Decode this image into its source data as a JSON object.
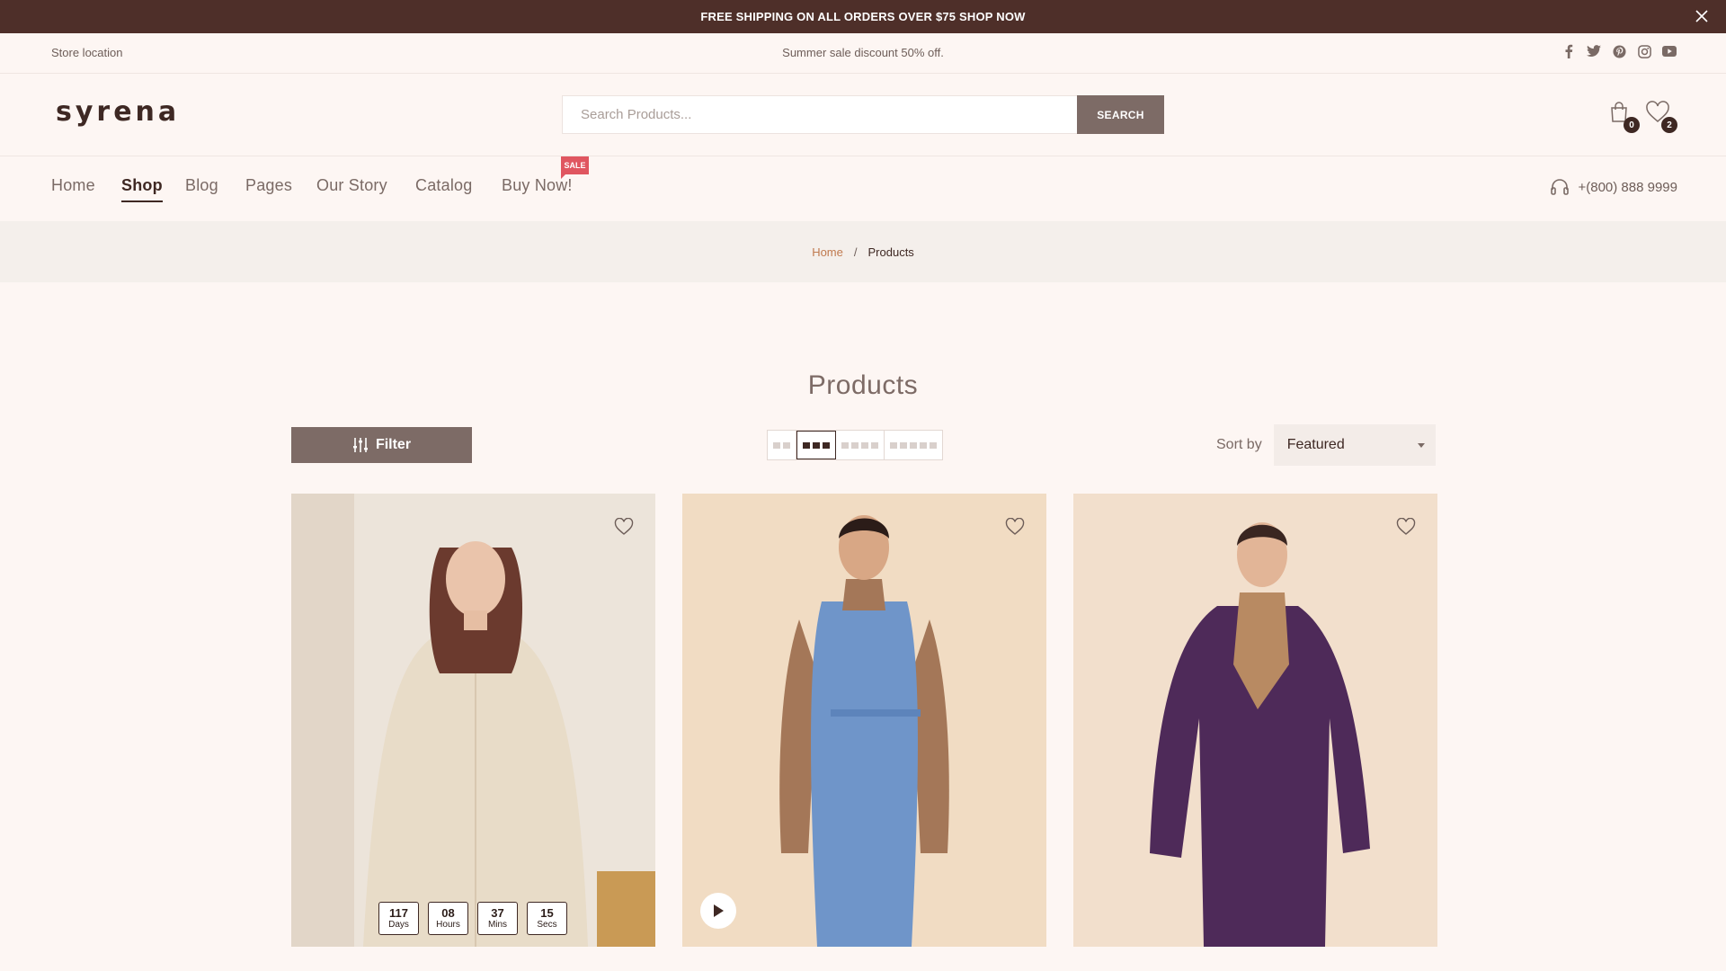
{
  "announcement": {
    "text": "FREE SHIPPING ON ALL ORDERS OVER $75 SHOP NOW"
  },
  "topbar": {
    "store_location": "Store location",
    "promo": "Summer sale discount 50% off.",
    "socials": [
      "facebook-icon",
      "twitter-icon",
      "pinterest-icon",
      "instagram-icon",
      "youtube-icon"
    ]
  },
  "header": {
    "logo": "syrena",
    "search_placeholder": "Search Products...",
    "search_button": "SEARCH",
    "cart_count": "0",
    "wishlist_count": "2"
  },
  "nav": {
    "items": [
      "Home",
      "Shop",
      "Blog",
      "Pages",
      "Our Story",
      "Catalog",
      "Buy Now!"
    ],
    "active": "Shop",
    "sale_badge": "SALE",
    "phone": "+(800) 888 9999"
  },
  "breadcrumb": {
    "home": "Home",
    "separator": "/",
    "current": "Products"
  },
  "page_title": "Products",
  "toolbar": {
    "filter_label": "Filter",
    "grid_options": [
      2,
      3,
      4,
      5
    ],
    "grid_selected": 3,
    "sort_label": "Sort by",
    "sort_value": "Featured"
  },
  "products": [
    {
      "countdown": [
        {
          "num": "117",
          "unit": "Days"
        },
        {
          "num": "08",
          "unit": "Hours"
        },
        {
          "num": "37",
          "unit": "Mins"
        },
        {
          "num": "15",
          "unit": "Secs"
        }
      ],
      "bg": "#ece4da",
      "garment": "#e8dcc8"
    },
    {
      "has_video": true,
      "bg": "#f1dcc3",
      "garment": "#6f95c9"
    },
    {
      "bg": "#f2dfcc",
      "garment": "#4e2a59"
    }
  ],
  "colors": {
    "brand_dark": "#4e2f29",
    "accent": "#7d6b66",
    "sale": "#e05660",
    "link": "#c07a4f"
  }
}
